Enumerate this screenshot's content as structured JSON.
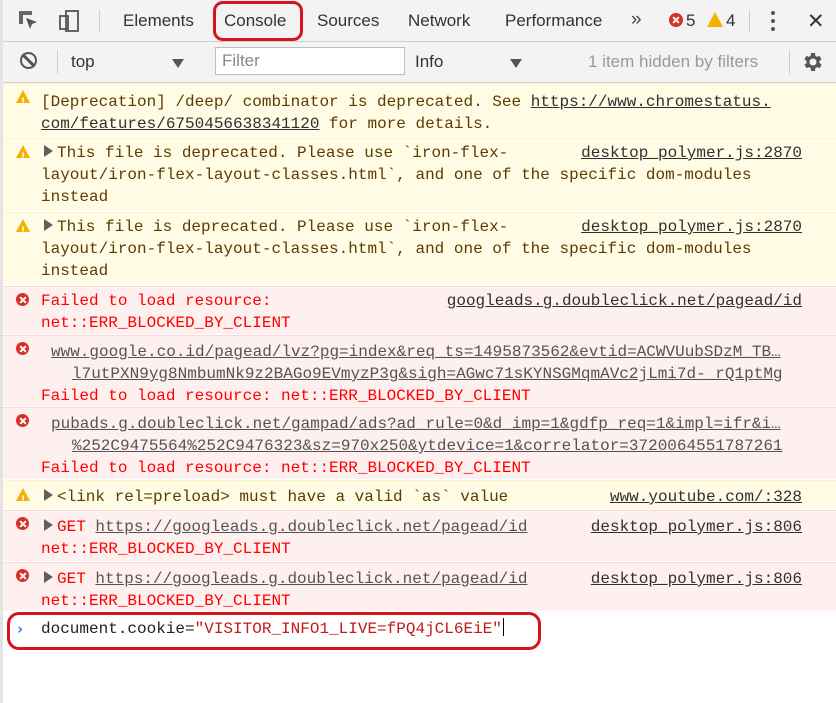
{
  "tabs": [
    {
      "label": "Elements"
    },
    {
      "label": "Console"
    },
    {
      "label": "Sources"
    },
    {
      "label": "Network"
    },
    {
      "label": "Performance"
    }
  ],
  "more_tabs_label": "»",
  "error_count": "5",
  "warning_count": "4",
  "close_label": "✕",
  "toolbar": {
    "context": "top",
    "filter_placeholder": "Filter",
    "level": "Info",
    "hidden_count": "1 item hidden by filters"
  },
  "messages": [
    {
      "type": "warning",
      "lines": [
        "[Deprecation] /deep/ combinator is deprecated. See ",
        "com/features/6750456638341120"
      ],
      "link1": "https://www.chromestatus.",
      "tail": " for more details."
    },
    {
      "type": "warning",
      "lines": [
        "This file is deprecated. Please use `iron-flex-",
        "layout/iron-flex-layout-classes.html`, and one of the specific dom-modules",
        "instead"
      ],
      "source": "desktop_polymer.js:2870"
    },
    {
      "type": "warning",
      "lines": [
        "This file is deprecated. Please use `iron-flex-",
        "layout/iron-flex-layout-classes.html`, and one of the specific dom-modules",
        "instead"
      ],
      "source": "desktop_polymer.js:2870"
    },
    {
      "type": "error",
      "lines": [
        "Failed to load resource:",
        "net::ERR_BLOCKED_BY_CLIENT"
      ],
      "source": "googleads.g.doubleclick.net/pagead/id"
    },
    {
      "type": "error",
      "lines": [
        "www.google.co.id/pagead/lvz?pg=index&req_ts=1495873562&evtid=ACWVUubSDzM_TB…",
        "l7utPXN9yg8NmbumNk9z2BAGo9EVmyzP3g&sigh=AGwc71sKYNSGMqmAVc2jLmi7d-_rQ1ptMg",
        "Failed to load resource: net::ERR_BLOCKED_BY_CLIENT"
      ]
    },
    {
      "type": "error",
      "lines": [
        "pubads.g.doubleclick.net/gampad/ads?ad_rule=0&d_imp=1&gdfp_req=1&impl=ifr&i…",
        "%252C9475564%252C9476323&sz=970x250&ytdevice=1&correlator=3720064551787261",
        "Failed to load resource: net::ERR_BLOCKED_BY_CLIENT"
      ]
    },
    {
      "type": "warning",
      "lines": [
        "<link rel=preload> must have a valid `as` value"
      ],
      "source": "www.youtube.com/:328"
    },
    {
      "type": "error",
      "lines": [
        "GET ",
        "https://googleads.g.doubleclick.net/pagead/id",
        "net::ERR_BLOCKED_BY_CLIENT"
      ],
      "source": "desktop_polymer.js:806"
    },
    {
      "type": "error",
      "lines": [
        "GET ",
        "https://googleads.g.doubleclick.net/pagead/id",
        "net::ERR_BLOCKED_BY_CLIENT"
      ],
      "source": "desktop_polymer.js:806"
    }
  ],
  "prompt": {
    "chevron": "›",
    "code": "document.cookie=",
    "string": "\"VISITOR_INFO1_LIVE=fPQ4jCL6EiE\""
  },
  "colors": {
    "highlight": "#d6141d",
    "error": "#ff0000",
    "warning_bg": "#fffbe5",
    "error_bg": "#fff0f0"
  }
}
